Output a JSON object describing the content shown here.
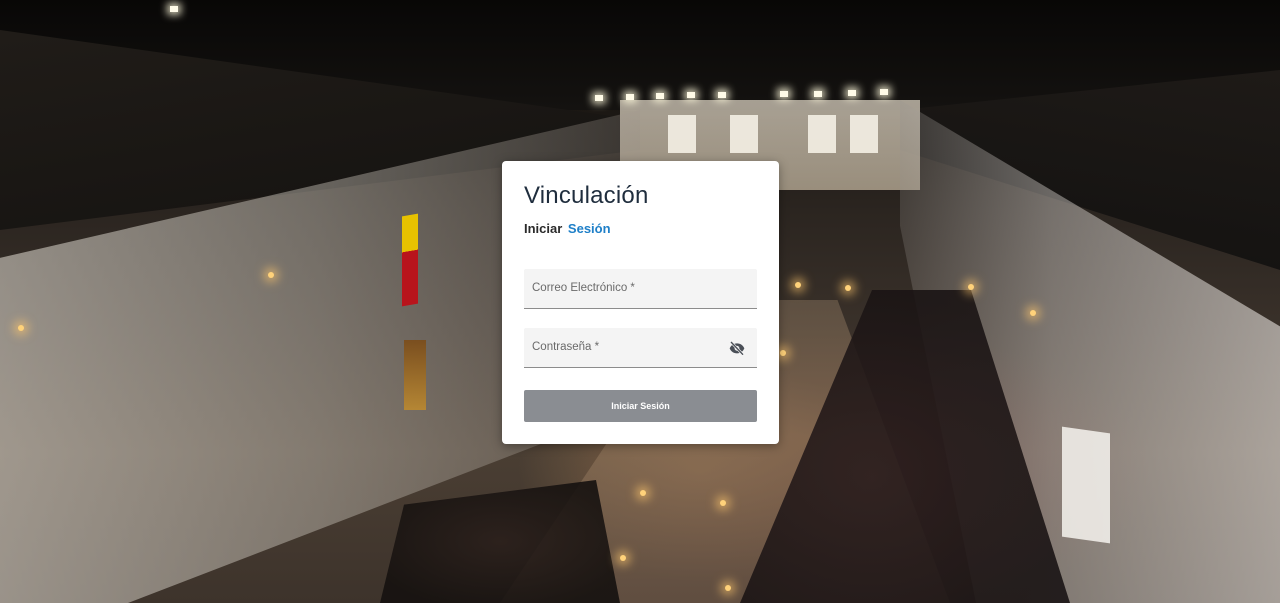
{
  "login": {
    "title": "Vinculación",
    "subtitle_word1": "Iniciar",
    "subtitle_word2": "Sesión",
    "email": {
      "label": "Correo Electrónico *",
      "value": ""
    },
    "password": {
      "label": "Contraseña *",
      "value": "",
      "toggle_icon": "eye-off-icon"
    },
    "submit_label": "Iniciar Sesión"
  },
  "colors": {
    "title": "#1f2d3d",
    "accent": "#1e7fc8",
    "button": "#8a8d92",
    "field_bg": "#f4f4f4"
  }
}
